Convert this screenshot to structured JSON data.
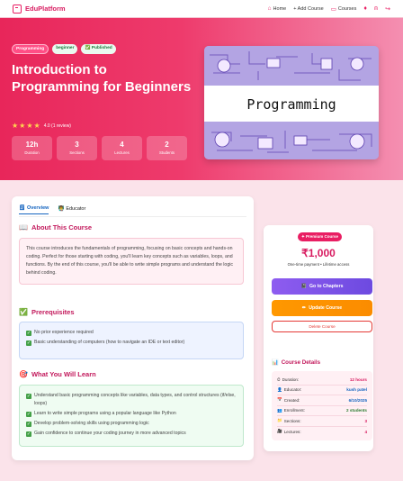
{
  "nav": {
    "brand": "EduPlatform",
    "links": [
      {
        "label": "Home"
      },
      {
        "label": "+ Add Course"
      },
      {
        "label": "Courses"
      }
    ]
  },
  "hero": {
    "badges": {
      "category": "Programming",
      "level": "beginner",
      "status": "Published"
    },
    "title": "Introduction to Programming for Beginners",
    "rating_text": "4.0 (1 review)",
    "stars": "★★★★",
    "stats": [
      {
        "value": "12h",
        "label": "Duration"
      },
      {
        "value": "3",
        "label": "Sections"
      },
      {
        "value": "4",
        "label": "Lectures"
      },
      {
        "value": "2",
        "label": "Students"
      }
    ],
    "thumbnail_text": "Programming"
  },
  "tabs": [
    {
      "label": "Overview",
      "active": true
    },
    {
      "label": "Educator",
      "active": false
    }
  ],
  "about": {
    "heading": "About This Course",
    "text": "This course introduces the fundamentals of programming, focusing on basic concepts and hands-on coding. Perfect for those starting with coding, you'll learn key concepts such as variables, loops, and functions. By the end of this course, you'll be able to write simple programs and understand the logic behind coding."
  },
  "prerequisites": {
    "heading": "Prerequisites",
    "items": [
      "No prior experience required",
      "Basic understanding of computers (how to navigate an IDE or text editor)"
    ]
  },
  "learn": {
    "heading": "What You Will Learn",
    "items": [
      "Understand basic programming concepts like variables, data types, and control structures (if/else, loops)",
      "Learn to write simple programs using a popular language like Python",
      "Develop problem-solving skills using programming logic",
      "Gain confidence to continue your coding journey in more advanced topics"
    ]
  },
  "sidebar": {
    "premium": "Premium Course",
    "price": "₹1,000",
    "price_note": "One-time payment • Lifetime access",
    "go_button": "Go to Chapters",
    "update_button": "Update Course",
    "delete_button": "Delete Course",
    "details_heading": "Course Details",
    "details": [
      {
        "label": "Duration:",
        "value": "12 hours"
      },
      {
        "label": "Educator:",
        "value": "kush patel"
      },
      {
        "label": "Created:",
        "value": "6/10/2025"
      },
      {
        "label": "Enrollment:",
        "value": "2 students"
      },
      {
        "label": "Sections:",
        "value": "3"
      },
      {
        "label": "Lectures:",
        "value": "4"
      }
    ]
  },
  "colors": {
    "accent": "#e91e63",
    "hero_start": "#e8265a",
    "hero_end": "#f48fb1"
  }
}
